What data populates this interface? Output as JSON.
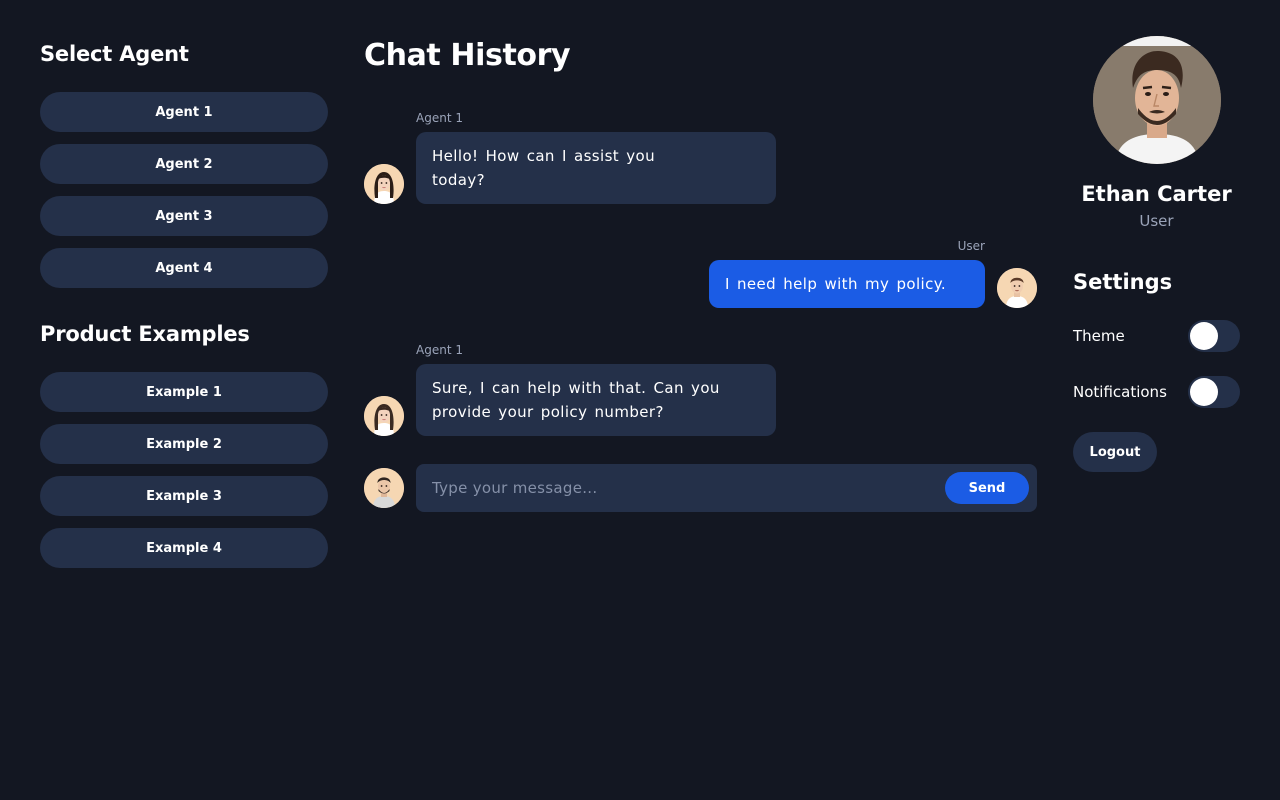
{
  "sidebar": {
    "agents_title": "Select Agent",
    "agents": [
      {
        "label": "Agent 1"
      },
      {
        "label": "Agent 2"
      },
      {
        "label": "Agent 3"
      },
      {
        "label": "Agent 4"
      }
    ],
    "examples_title": "Product Examples",
    "examples": [
      {
        "label": "Example 1"
      },
      {
        "label": "Example 2"
      },
      {
        "label": "Example 3"
      },
      {
        "label": "Example 4"
      }
    ]
  },
  "chat": {
    "title": "Chat History",
    "messages": [
      {
        "sender": "Agent 1",
        "role": "agent",
        "text": "Hello! How can I assist you today?"
      },
      {
        "sender": "User",
        "role": "user",
        "text": "I need help with my policy."
      },
      {
        "sender": "Agent 1",
        "role": "agent",
        "text": "Sure, I can help with that. Can you provide your policy number?"
      }
    ],
    "input_placeholder": "Type your message...",
    "send_label": "Send"
  },
  "profile": {
    "name": "Ethan Carter",
    "role": "User"
  },
  "settings": {
    "title": "Settings",
    "theme_label": "Theme",
    "theme_on": false,
    "notifications_label": "Notifications",
    "notifications_on": false,
    "logout_label": "Logout"
  },
  "colors": {
    "background": "#131722",
    "surface": "#243049",
    "accent": "#1b5ce5",
    "muted_text": "#9aa3b8"
  },
  "icons": {
    "agent_avatar": "female-agent-avatar",
    "user_avatar": "male-user-avatar",
    "profile_photo": "ethan-carter-photo"
  }
}
